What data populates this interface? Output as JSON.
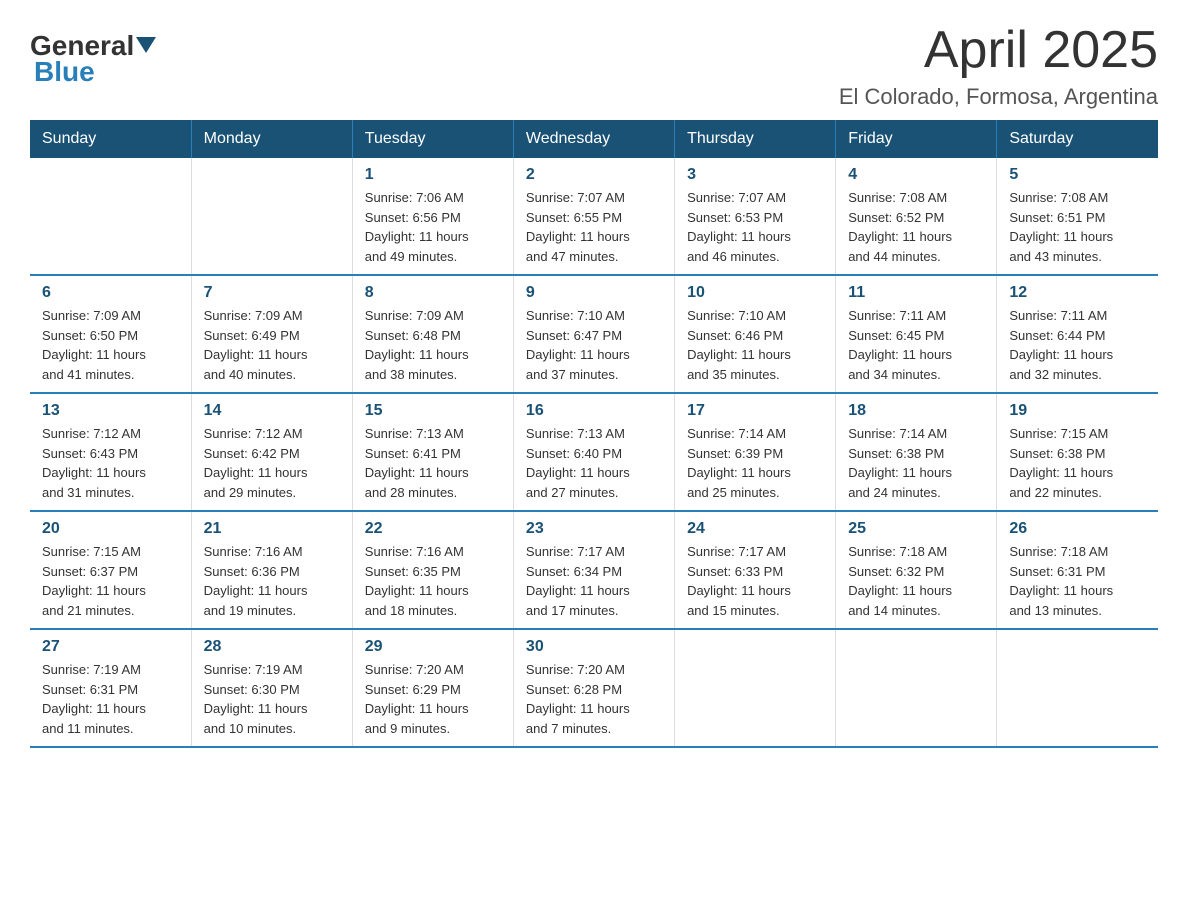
{
  "logo": {
    "general": "General",
    "blue": "Blue"
  },
  "title": "April 2025",
  "subtitle": "El Colorado, Formosa, Argentina",
  "weekdays": [
    "Sunday",
    "Monday",
    "Tuesday",
    "Wednesday",
    "Thursday",
    "Friday",
    "Saturday"
  ],
  "weeks": [
    [
      {
        "day": "",
        "info": ""
      },
      {
        "day": "",
        "info": ""
      },
      {
        "day": "1",
        "info": "Sunrise: 7:06 AM\nSunset: 6:56 PM\nDaylight: 11 hours\nand 49 minutes."
      },
      {
        "day": "2",
        "info": "Sunrise: 7:07 AM\nSunset: 6:55 PM\nDaylight: 11 hours\nand 47 minutes."
      },
      {
        "day": "3",
        "info": "Sunrise: 7:07 AM\nSunset: 6:53 PM\nDaylight: 11 hours\nand 46 minutes."
      },
      {
        "day": "4",
        "info": "Sunrise: 7:08 AM\nSunset: 6:52 PM\nDaylight: 11 hours\nand 44 minutes."
      },
      {
        "day": "5",
        "info": "Sunrise: 7:08 AM\nSunset: 6:51 PM\nDaylight: 11 hours\nand 43 minutes."
      }
    ],
    [
      {
        "day": "6",
        "info": "Sunrise: 7:09 AM\nSunset: 6:50 PM\nDaylight: 11 hours\nand 41 minutes."
      },
      {
        "day": "7",
        "info": "Sunrise: 7:09 AM\nSunset: 6:49 PM\nDaylight: 11 hours\nand 40 minutes."
      },
      {
        "day": "8",
        "info": "Sunrise: 7:09 AM\nSunset: 6:48 PM\nDaylight: 11 hours\nand 38 minutes."
      },
      {
        "day": "9",
        "info": "Sunrise: 7:10 AM\nSunset: 6:47 PM\nDaylight: 11 hours\nand 37 minutes."
      },
      {
        "day": "10",
        "info": "Sunrise: 7:10 AM\nSunset: 6:46 PM\nDaylight: 11 hours\nand 35 minutes."
      },
      {
        "day": "11",
        "info": "Sunrise: 7:11 AM\nSunset: 6:45 PM\nDaylight: 11 hours\nand 34 minutes."
      },
      {
        "day": "12",
        "info": "Sunrise: 7:11 AM\nSunset: 6:44 PM\nDaylight: 11 hours\nand 32 minutes."
      }
    ],
    [
      {
        "day": "13",
        "info": "Sunrise: 7:12 AM\nSunset: 6:43 PM\nDaylight: 11 hours\nand 31 minutes."
      },
      {
        "day": "14",
        "info": "Sunrise: 7:12 AM\nSunset: 6:42 PM\nDaylight: 11 hours\nand 29 minutes."
      },
      {
        "day": "15",
        "info": "Sunrise: 7:13 AM\nSunset: 6:41 PM\nDaylight: 11 hours\nand 28 minutes."
      },
      {
        "day": "16",
        "info": "Sunrise: 7:13 AM\nSunset: 6:40 PM\nDaylight: 11 hours\nand 27 minutes."
      },
      {
        "day": "17",
        "info": "Sunrise: 7:14 AM\nSunset: 6:39 PM\nDaylight: 11 hours\nand 25 minutes."
      },
      {
        "day": "18",
        "info": "Sunrise: 7:14 AM\nSunset: 6:38 PM\nDaylight: 11 hours\nand 24 minutes."
      },
      {
        "day": "19",
        "info": "Sunrise: 7:15 AM\nSunset: 6:38 PM\nDaylight: 11 hours\nand 22 minutes."
      }
    ],
    [
      {
        "day": "20",
        "info": "Sunrise: 7:15 AM\nSunset: 6:37 PM\nDaylight: 11 hours\nand 21 minutes."
      },
      {
        "day": "21",
        "info": "Sunrise: 7:16 AM\nSunset: 6:36 PM\nDaylight: 11 hours\nand 19 minutes."
      },
      {
        "day": "22",
        "info": "Sunrise: 7:16 AM\nSunset: 6:35 PM\nDaylight: 11 hours\nand 18 minutes."
      },
      {
        "day": "23",
        "info": "Sunrise: 7:17 AM\nSunset: 6:34 PM\nDaylight: 11 hours\nand 17 minutes."
      },
      {
        "day": "24",
        "info": "Sunrise: 7:17 AM\nSunset: 6:33 PM\nDaylight: 11 hours\nand 15 minutes."
      },
      {
        "day": "25",
        "info": "Sunrise: 7:18 AM\nSunset: 6:32 PM\nDaylight: 11 hours\nand 14 minutes."
      },
      {
        "day": "26",
        "info": "Sunrise: 7:18 AM\nSunset: 6:31 PM\nDaylight: 11 hours\nand 13 minutes."
      }
    ],
    [
      {
        "day": "27",
        "info": "Sunrise: 7:19 AM\nSunset: 6:31 PM\nDaylight: 11 hours\nand 11 minutes."
      },
      {
        "day": "28",
        "info": "Sunrise: 7:19 AM\nSunset: 6:30 PM\nDaylight: 11 hours\nand 10 minutes."
      },
      {
        "day": "29",
        "info": "Sunrise: 7:20 AM\nSunset: 6:29 PM\nDaylight: 11 hours\nand 9 minutes."
      },
      {
        "day": "30",
        "info": "Sunrise: 7:20 AM\nSunset: 6:28 PM\nDaylight: 11 hours\nand 7 minutes."
      },
      {
        "day": "",
        "info": ""
      },
      {
        "day": "",
        "info": ""
      },
      {
        "day": "",
        "info": ""
      }
    ]
  ]
}
